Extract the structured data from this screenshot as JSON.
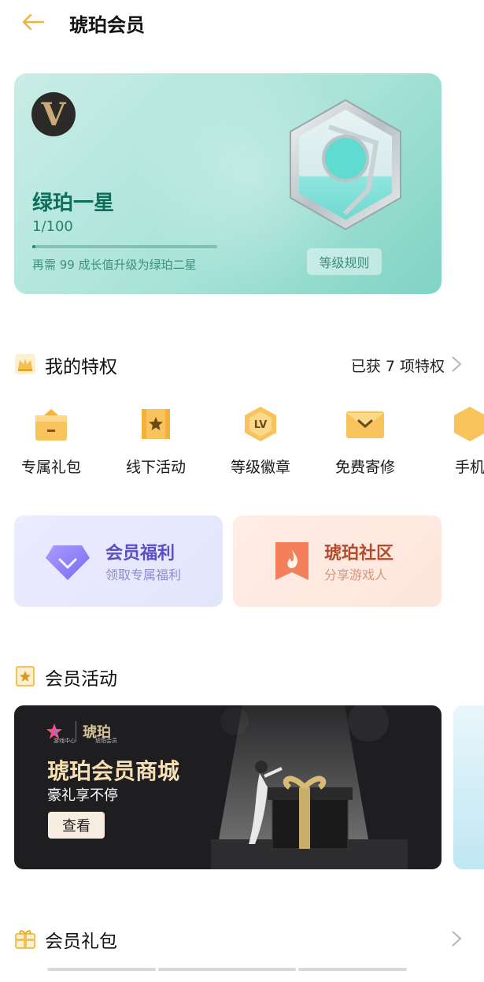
{
  "header": {
    "title": "琥珀会员"
  },
  "level_card": {
    "logo_letter": "V",
    "level_name": "绿珀一星",
    "progress_text": "1/100",
    "progress_fraction": 0.01,
    "upgrade_hint": "再需 99 成长值升级为绿珀二星",
    "rules_button": "等级规则"
  },
  "privileges": {
    "title": "我的特权",
    "count_text": "已获 7 项特权",
    "items": [
      {
        "label": "专属礼包",
        "icon": "gift-box-icon"
      },
      {
        "label": "线下活动",
        "icon": "star-flag-icon"
      },
      {
        "label": "等级徽章",
        "icon": "lv-badge-icon"
      },
      {
        "label": "免费寄修",
        "icon": "envelope-icon"
      },
      {
        "label": "手机",
        "icon": "hexagon-icon"
      }
    ]
  },
  "tiles": {
    "welfare": {
      "title": "会员福利",
      "subtitle": "领取专属福利"
    },
    "community": {
      "title": "琥珀社区",
      "subtitle": "分享游戏人"
    }
  },
  "activities": {
    "title": "会员活动",
    "banner": {
      "logo_left": "游戏中心",
      "logo_brand": "琥珀",
      "logo_right": "琥珀会员",
      "title": "琥珀会员商城",
      "subtitle": "豪礼享不停",
      "button": "查看"
    }
  },
  "gift_packs": {
    "title": "会员礼包"
  },
  "colors": {
    "accent_gold": "#f0b43c",
    "card_green": "#a9e3d8",
    "level_text": "#0f6e5b",
    "purple": "#5b4ec9",
    "orange": "#b44b2c"
  }
}
